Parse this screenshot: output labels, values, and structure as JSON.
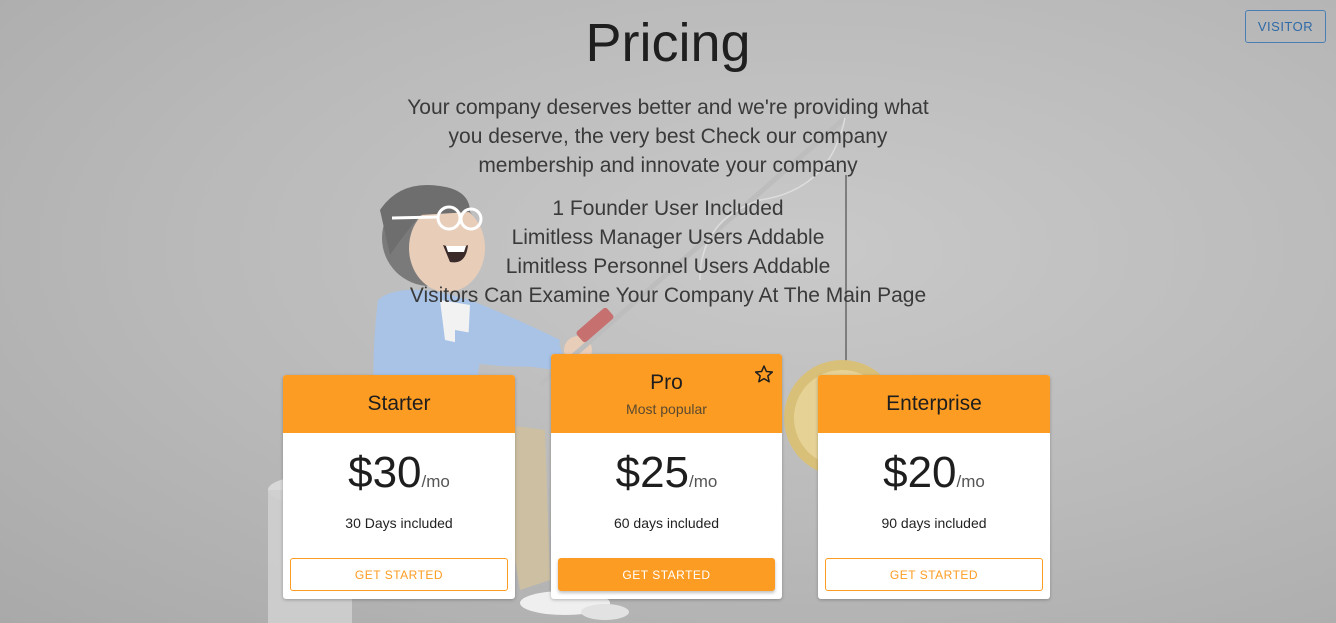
{
  "header": {
    "visitor_label": "VISITOR"
  },
  "page": {
    "title": "Pricing",
    "intro": "Your company deserves better and we're providing what you deserve, the very best Check our company membership and innovate your company",
    "features": [
      "1 Founder User Included",
      "Limitless Manager Users Addable",
      "Limitless Personnel Users Addable",
      "Visitors Can Examine Your Company At The Main Page"
    ]
  },
  "plans": [
    {
      "title": "Starter",
      "subtitle": "",
      "price": "$30",
      "period": "/mo",
      "included": "30 Days included",
      "cta": "GET STARTED",
      "featured": false
    },
    {
      "title": "Pro",
      "subtitle": "Most popular",
      "price": "$25",
      "period": "/mo",
      "included": "60 days included",
      "cta": "GET STARTED",
      "featured": true,
      "icon": "star-outline-icon"
    },
    {
      "title": "Enterprise",
      "subtitle": "",
      "price": "$20",
      "period": "/mo",
      "included": "90 days included",
      "cta": "GET STARTED",
      "featured": false
    }
  ],
  "colors": {
    "accent": "#fd9c22",
    "visitor_button": "#2f6aa8",
    "background": "#bdbdbd"
  }
}
